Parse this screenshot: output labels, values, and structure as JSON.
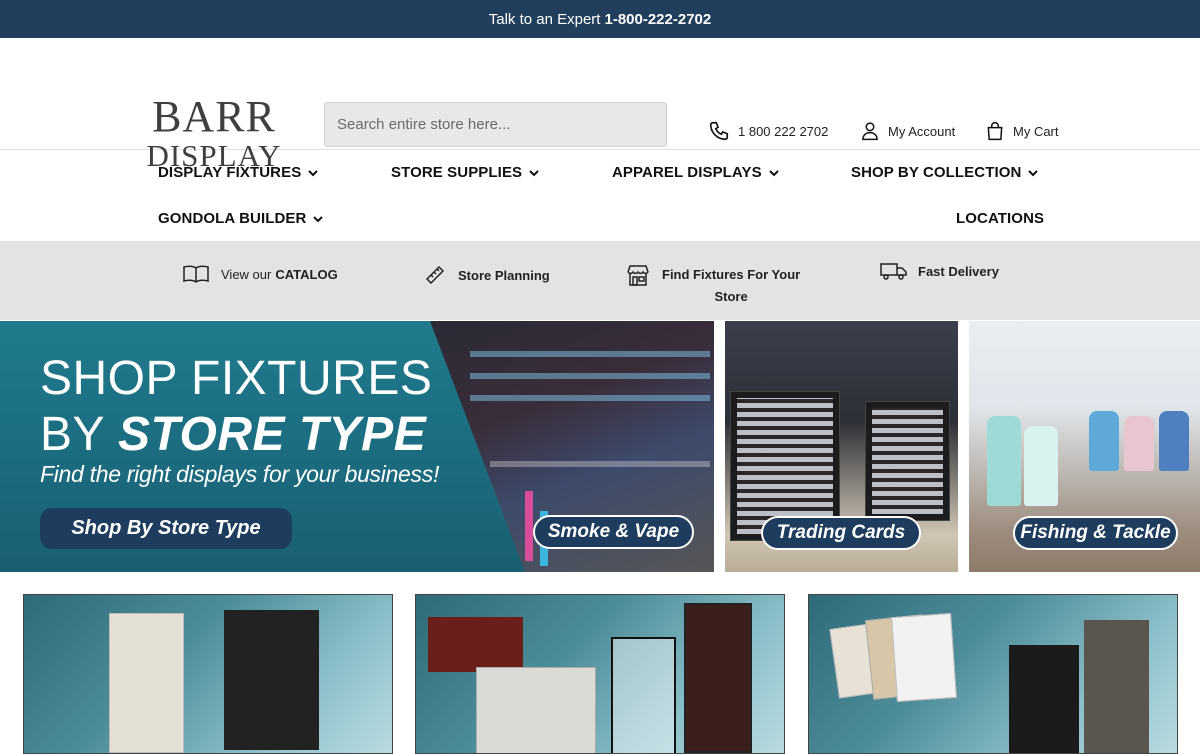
{
  "topbar": {
    "prefix": "Talk to an Expert",
    "phone": "1-800-222-2702"
  },
  "header": {
    "logo_line1": "BARR",
    "logo_line2": "DISPLAY",
    "search_placeholder": "Search entire store here...",
    "phone_label": "1 800 222 2702",
    "account_label": "My Account",
    "cart_label": "My Cart"
  },
  "nav": {
    "items": [
      {
        "label": "DISPLAY FIXTURES",
        "has_dropdown": true
      },
      {
        "label": "STORE SUPPLIES",
        "has_dropdown": true
      },
      {
        "label": "APPAREL DISPLAYS",
        "has_dropdown": true
      },
      {
        "label": "SHOP BY COLLECTION",
        "has_dropdown": true
      },
      {
        "label": "GONDOLA BUILDER",
        "has_dropdown": true
      },
      {
        "label": "LOCATIONS",
        "has_dropdown": false
      }
    ]
  },
  "features": {
    "catalog_pre": "View our",
    "catalog": "CATALOG",
    "planning": "Store Planning",
    "find_line1": "Find Fixtures For Your",
    "find_line2": "Store",
    "delivery": "Fast Delivery"
  },
  "hero": {
    "line1": "SHOP FIXTURES",
    "line2_pre": "BY",
    "line2_em": "STORE TYPE",
    "subtitle": "Find the right displays for your business!",
    "cta": "Shop By Store Type",
    "tiles": [
      {
        "label": "Smoke & Vape"
      },
      {
        "label": "Trading Cards"
      },
      {
        "label": "Fishing & Tackle"
      }
    ]
  },
  "colors": {
    "topbar": "#213e5c",
    "hero_teal": "#1f7b8c",
    "pill_navy": "#1d3c5e",
    "features_bg": "#e3e3e3"
  }
}
